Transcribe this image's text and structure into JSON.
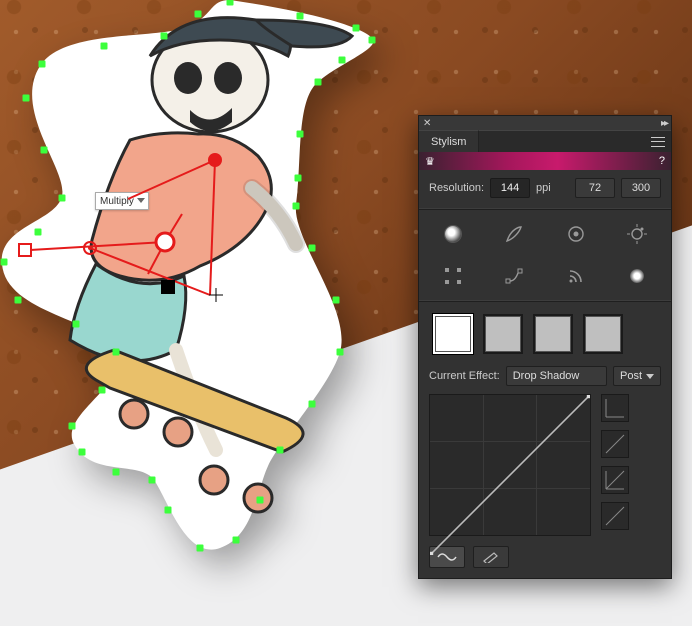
{
  "canvas": {
    "blend_mode": "Multiply"
  },
  "panel": {
    "title": "Stylism",
    "help": "?",
    "resolution_label": "Resolution:",
    "resolution_value": "144",
    "resolution_unit": "ppi",
    "res_presets": [
      "72",
      "300"
    ],
    "effect_icons": [
      "shadow",
      "feather",
      "target",
      "halo",
      "registration",
      "path",
      "rss",
      "glow"
    ],
    "active_effect_icon": 0,
    "swatch_selected": 0,
    "current_effect_label": "Current Effect:",
    "current_effect_value": "Drop Shadow",
    "post_label": "Post",
    "curve_presets": [
      "flat",
      "linear",
      "invert",
      "linear2"
    ],
    "bottom_buttons": [
      "wave",
      "pencil"
    ]
  }
}
